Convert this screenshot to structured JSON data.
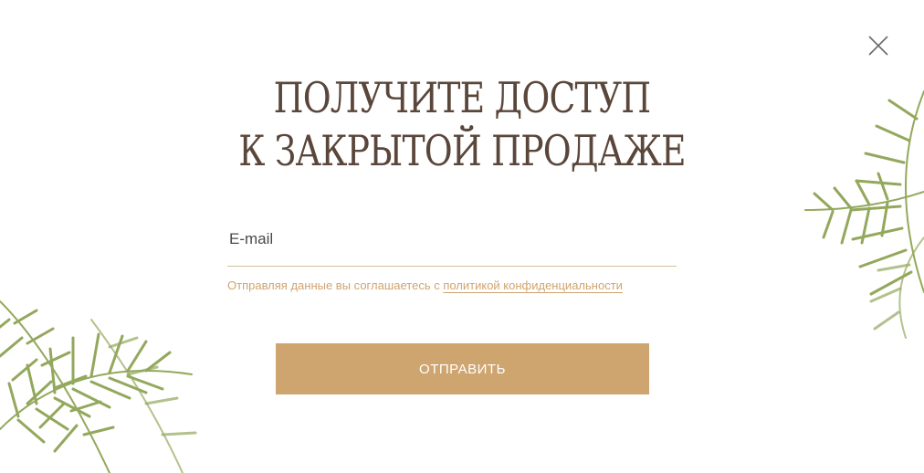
{
  "popup": {
    "headline_line1": "ПОЛУЧИТЕ ДОСТУП",
    "headline_line2": "К ЗАКРЫТОЙ ПРОДАЖЕ",
    "email_placeholder": "E-mail",
    "email_value": "",
    "consent_text": "Отправляя данные вы соглашаетесь с ",
    "consent_link": "политикой конфиденциальности",
    "submit_label": "ОТПРАВИТЬ",
    "close_icon": "close-icon"
  },
  "colors": {
    "heading": "#5a463a",
    "accent": "#cfa56f",
    "underline": "#d4c39c",
    "leaf": "#8fa45a"
  }
}
